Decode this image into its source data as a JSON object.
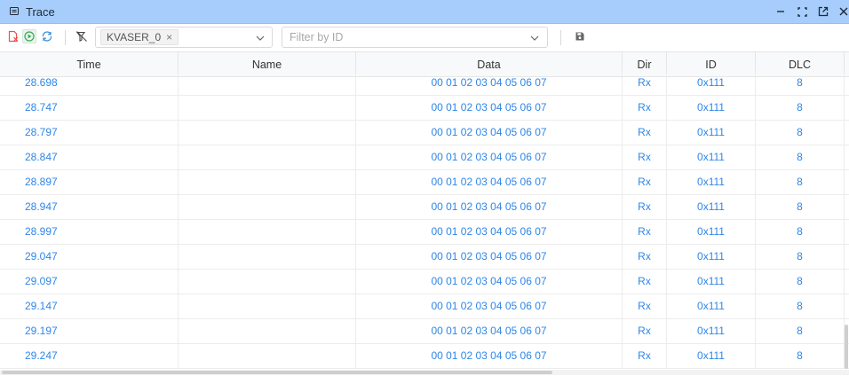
{
  "window": {
    "title": "Trace",
    "title_icon": "terminal-window-icon",
    "controls": [
      "minimize-icon",
      "restore-icon",
      "popout-icon",
      "close-icon"
    ]
  },
  "toolbar": {
    "icons": [
      "clear-trace-icon",
      "start-play-icon",
      "auto-scroll-icon",
      "clear-filter-icon",
      "save-icon"
    ],
    "channel_select": {
      "tag": "KVASER_0",
      "tag_remove": "×"
    },
    "id_filter": {
      "placeholder": "Filter by ID"
    }
  },
  "table": {
    "columns": [
      "Time",
      "Name",
      "Data",
      "Dir",
      "ID",
      "DLC"
    ],
    "rows": [
      {
        "time": "28.698",
        "name": "",
        "data": "00 01 02 03 04 05 06 07",
        "dir": "Rx",
        "id": "0x111",
        "dlc": "8"
      },
      {
        "time": "28.747",
        "name": "",
        "data": "00 01 02 03 04 05 06 07",
        "dir": "Rx",
        "id": "0x111",
        "dlc": "8"
      },
      {
        "time": "28.797",
        "name": "",
        "data": "00 01 02 03 04 05 06 07",
        "dir": "Rx",
        "id": "0x111",
        "dlc": "8"
      },
      {
        "time": "28.847",
        "name": "",
        "data": "00 01 02 03 04 05 06 07",
        "dir": "Rx",
        "id": "0x111",
        "dlc": "8"
      },
      {
        "time": "28.897",
        "name": "",
        "data": "00 01 02 03 04 05 06 07",
        "dir": "Rx",
        "id": "0x111",
        "dlc": "8"
      },
      {
        "time": "28.947",
        "name": "",
        "data": "00 01 02 03 04 05 06 07",
        "dir": "Rx",
        "id": "0x111",
        "dlc": "8"
      },
      {
        "time": "28.997",
        "name": "",
        "data": "00 01 02 03 04 05 06 07",
        "dir": "Rx",
        "id": "0x111",
        "dlc": "8"
      },
      {
        "time": "29.047",
        "name": "",
        "data": "00 01 02 03 04 05 06 07",
        "dir": "Rx",
        "id": "0x111",
        "dlc": "8"
      },
      {
        "time": "29.097",
        "name": "",
        "data": "00 01 02 03 04 05 06 07",
        "dir": "Rx",
        "id": "0x111",
        "dlc": "8"
      },
      {
        "time": "29.147",
        "name": "",
        "data": "00 01 02 03 04 05 06 07",
        "dir": "Rx",
        "id": "0x111",
        "dlc": "8"
      },
      {
        "time": "29.197",
        "name": "",
        "data": "00 01 02 03 04 05 06 07",
        "dir": "Rx",
        "id": "0x111",
        "dlc": "8"
      },
      {
        "time": "29.247",
        "name": "",
        "data": "00 01 02 03 04 05 06 07",
        "dir": "Rx",
        "id": "0x111",
        "dlc": "8"
      }
    ]
  },
  "colors": {
    "titlebar": "#a6cdfb",
    "cell_text": "#2f86e8",
    "clear_icon": "#e8524f",
    "play_icon": "#3aa655",
    "autoscroll_icon": "#3b8fe0"
  }
}
